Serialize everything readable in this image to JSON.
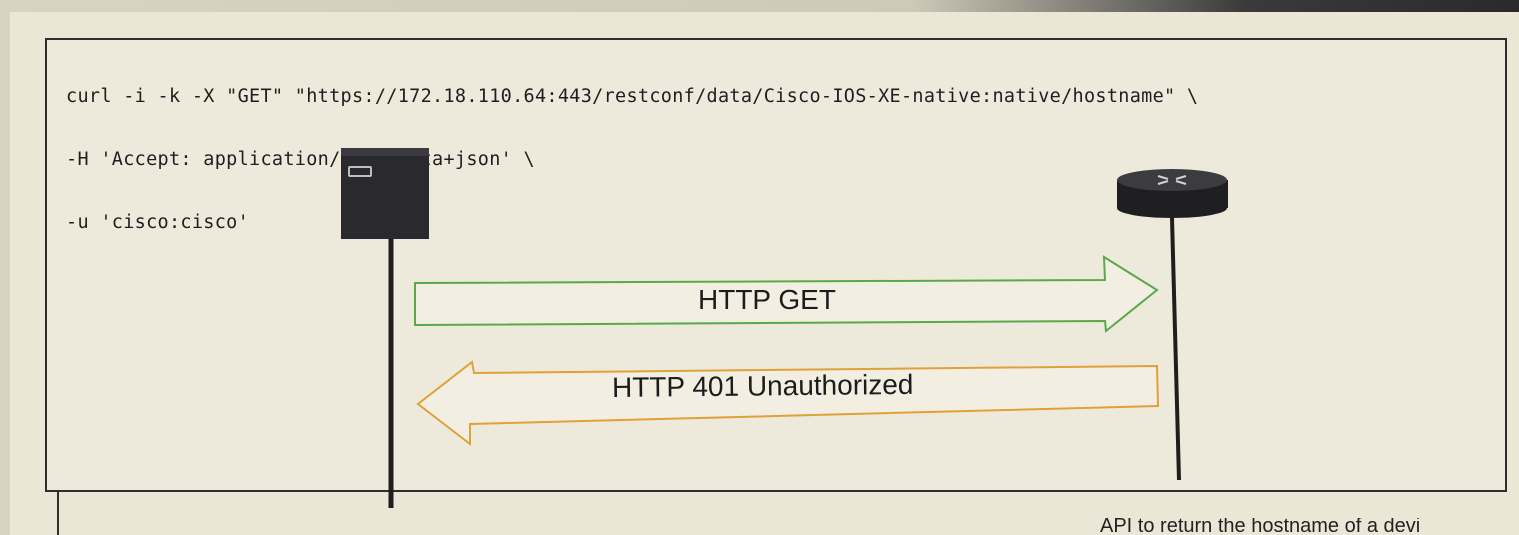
{
  "code": {
    "line1": "curl -i -k -X \"GET\" \"https://172.18.110.64:443/restconf/data/Cisco-IOS-XE-native:native/hostname\" \\",
    "line2": "-H 'Accept: application/yang-data+json' \\",
    "line3": "-u 'cisco:cisco'"
  },
  "diagram": {
    "client_icon": "server-icon",
    "device_icon": "router-icon",
    "request_label": "HTTP GET",
    "response_label": "HTTP 401 Unauthorized",
    "request_arrow_color": "#5aa84a",
    "response_arrow_color": "#e0a03a"
  },
  "footer": {
    "partial_text": "API to return the hostname of a devi"
  }
}
